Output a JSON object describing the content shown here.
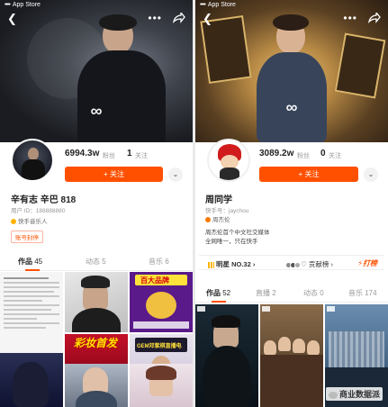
{
  "left": {
    "status_bar": {
      "carrier": "App Store"
    },
    "profile": {
      "followers_count": "6994.3w",
      "followers_label": "粉丝",
      "following_count": "1",
      "following_label": "关注",
      "follow_button": "+ 关注",
      "name": "辛有志 辛巴 818",
      "user_id": "用户 ID：188888880",
      "verification": "快手音乐人",
      "tag": "账号封停"
    },
    "tabs": [
      {
        "label": "作品",
        "count": "45"
      },
      {
        "label": "动态",
        "count": "5"
      },
      {
        "label": "音乐",
        "count": "6"
      }
    ],
    "thumbs": [
      {
        "text": ""
      },
      {
        "text": ""
      },
      {
        "text": "百大品牌"
      },
      {
        "text": ""
      },
      {
        "text": "彩妆首发"
      },
      {
        "text": "GEM邓紫棋直播电"
      },
      {
        "text": ""
      },
      {
        "text": ""
      },
      {
        "text": ""
      }
    ]
  },
  "right": {
    "status_bar": {
      "carrier": "App Store"
    },
    "profile": {
      "followers_count": "3089.2w",
      "followers_label": "粉丝",
      "following_count": "0",
      "following_label": "关注",
      "follow_button": "+ 关注",
      "name": "周同学",
      "user_id": "快手号：jaychou",
      "verification": "周杰伦",
      "bio_line1": "周杰伦首个中文社交媒体",
      "bio_line2": "全网唯一，只在快手"
    },
    "rank": {
      "label": "明星 NO.32",
      "gift_label": "贡献榜",
      "hit_label": "打榜"
    },
    "tabs": [
      {
        "label": "作品",
        "count": "52"
      },
      {
        "label": "直播",
        "count": "2"
      },
      {
        "label": "动态",
        "count": "0"
      },
      {
        "label": "音乐",
        "count": "174"
      }
    ],
    "thumbs": [
      {
        "text": ""
      },
      {
        "text": ""
      },
      {
        "text": ""
      }
    ]
  },
  "watermark": "商业数据派",
  "colors": {
    "accent": "#ff5000",
    "gold": "#ffb300"
  }
}
